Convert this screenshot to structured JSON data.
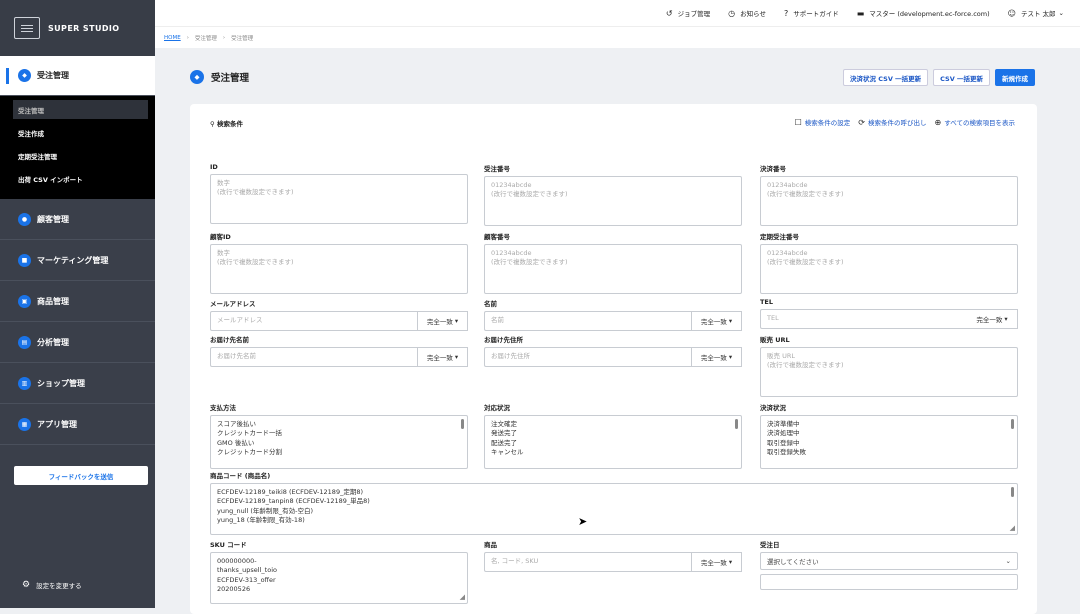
{
  "app": {
    "logo_text": "SUPER STUDIO"
  },
  "sidebar": {
    "active": {
      "label": "受注管理",
      "icon": "order-icon"
    },
    "subitems": [
      "受注管理",
      "受注作成",
      "定期受注管理",
      "出荷 CSV インポート"
    ],
    "items": [
      {
        "label": "顧客管理",
        "icon": "customer-icon"
      },
      {
        "label": "マーケティング管理",
        "icon": "marketing-icon"
      },
      {
        "label": "商品管理",
        "icon": "product-icon"
      },
      {
        "label": "分析管理",
        "icon": "analytics-icon"
      },
      {
        "label": "ショップ管理",
        "icon": "shop-icon"
      },
      {
        "label": "アプリ管理",
        "icon": "app-icon"
      }
    ],
    "feedback": "フィードバックを送信",
    "settings": "設定を変更する"
  },
  "topbar": {
    "job": "ジョブ管理",
    "news": "お知らせ",
    "support": "サポートガイド",
    "shop": "マスター (development.ec-force.com)",
    "user": "テスト 太郎"
  },
  "breadcrumb": {
    "home": "HOME",
    "b1": "受注管理",
    "b2": "受注管理"
  },
  "page": {
    "title": "受注管理"
  },
  "actions": {
    "csv_status": "決済状況 CSV 一括更新",
    "csv_bulk": "CSV 一括更新",
    "new": "新規作成"
  },
  "search": {
    "title": "検索条件",
    "save": "検索条件の設定",
    "recall": "検索条件の呼び出し",
    "showall": "すべての検索項目を表示"
  },
  "fields": {
    "id": {
      "label": "ID",
      "placeholder": "数字\n(改行で複数設定できます)"
    },
    "order_no": {
      "label": "受注番号",
      "placeholder": "01234abcde\n(改行で複数設定できます)"
    },
    "payment_no": {
      "label": "決済番号",
      "placeholder": "01234abcde\n(改行で複数設定できます)"
    },
    "customer_id": {
      "label": "顧客ID",
      "placeholder": "数字\n(改行で複数設定できます)"
    },
    "customer_no": {
      "label": "顧客番号",
      "placeholder": "01234abcde\n(改行で複数設定できます)"
    },
    "sub_no": {
      "label": "定期受注番号",
      "placeholder": "01234abcde\n(改行で複数設定できます)"
    },
    "email": {
      "label": "メールアドレス",
      "placeholder": "メールアドレス",
      "match": "完全一致"
    },
    "name": {
      "label": "名前",
      "placeholder": "名前",
      "match": "完全一致"
    },
    "tel": {
      "label": "TEL",
      "placeholder": "TEL",
      "match": "完全一致"
    },
    "ship_name": {
      "label": "お届け先名前",
      "placeholder": "お届け先名前",
      "match": "完全一致"
    },
    "ship_addr": {
      "label": "お届け先住所",
      "placeholder": "お届け先住所",
      "match": "完全一致"
    },
    "sales_url": {
      "label": "販売 URL",
      "placeholder": "販売 URL\n(改行で複数設定できます)"
    },
    "pay_method": {
      "label": "支払方法",
      "options": "スコア後払い\nクレジットカード一括\nGMO 後払い\nクレジットカード分割"
    },
    "ship_status": {
      "label": "対応状況",
      "options": "注文確定\n発送完了\n配送完了\nキャンセル"
    },
    "pay_status": {
      "label": "決済状況",
      "options": "決済準備中\n決済処理中\n取引登録中\n取引登録失敗"
    },
    "product_code": {
      "label": "商品コード (商品名)",
      "options": "ECFDEV-12189_teiki8 (ECFDEV-12189_定期8)\nECFDEV-12189_tanpin8 (ECFDEV-12189_単品8)\nyung_null (年齢制限_有効-空白)\nyung_18 (年齢制限_有効-18)"
    },
    "sku": {
      "label": "SKU コード",
      "options": "000000000-\nthanks_upsell_toio\nECFDEV-313_offer\n20200526"
    },
    "product": {
      "label": "商品",
      "placeholder": "名, コード, SKU",
      "match": "完全一致"
    },
    "order_date": {
      "label": "受注日",
      "placeholder": "選択してください"
    }
  }
}
